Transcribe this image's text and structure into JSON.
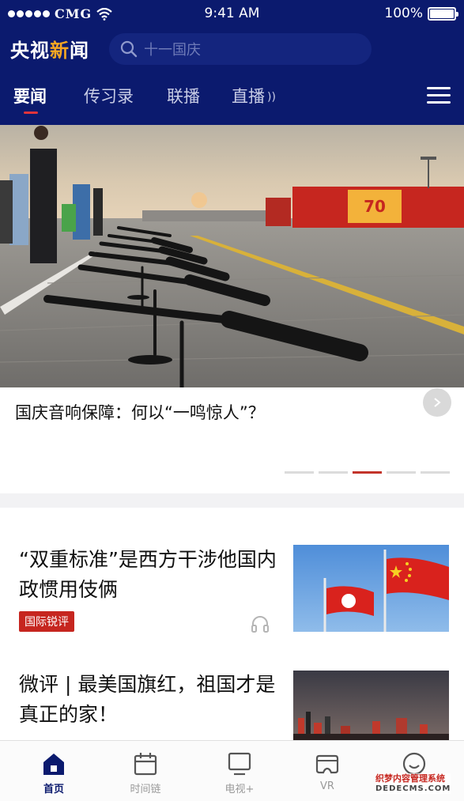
{
  "status_bar": {
    "carrier": "CMG",
    "time": "9:41 AM",
    "battery": "100%"
  },
  "header": {
    "brand_part1": "央视",
    "brand_part2": "新",
    "brand_part3": "闻",
    "search_placeholder": "十一国庆"
  },
  "tabs": [
    {
      "label": "要闻",
      "active": true
    },
    {
      "label": "传习录",
      "active": false
    },
    {
      "label": "联播",
      "active": false
    },
    {
      "label": "直播",
      "active": false
    }
  ],
  "hero": {
    "caption": "国庆音响保障：何以“一鸣惊人”？",
    "screen_number": "70",
    "pager_total": 5,
    "pager_active": 3
  },
  "news": [
    {
      "title": "“双重标准”是西方干涉他国内政惯用伎俩",
      "tag": "国际锐评"
    },
    {
      "title": "微评 | 最美国旗红，祖国才是真正的家！"
    }
  ],
  "tabbar": [
    {
      "label": "首页",
      "icon": "home-icon",
      "active": true
    },
    {
      "label": "时间链",
      "icon": "calendar-icon",
      "active": false
    },
    {
      "label": "电视+",
      "icon": "tv-icon",
      "active": false
    },
    {
      "label": "VR",
      "icon": "vr-headset-icon",
      "active": false
    },
    {
      "label": "",
      "icon": "smile-icon",
      "active": false
    }
  ],
  "watermark": {
    "line1": "织梦内容管理系统",
    "line2": "DEDECMS.COM"
  },
  "colors": {
    "header_bg": "#0b1a6e",
    "brand_accent": "#f5a623",
    "tag_red": "#c6261f",
    "active_tab_underline": "#e0343b"
  }
}
